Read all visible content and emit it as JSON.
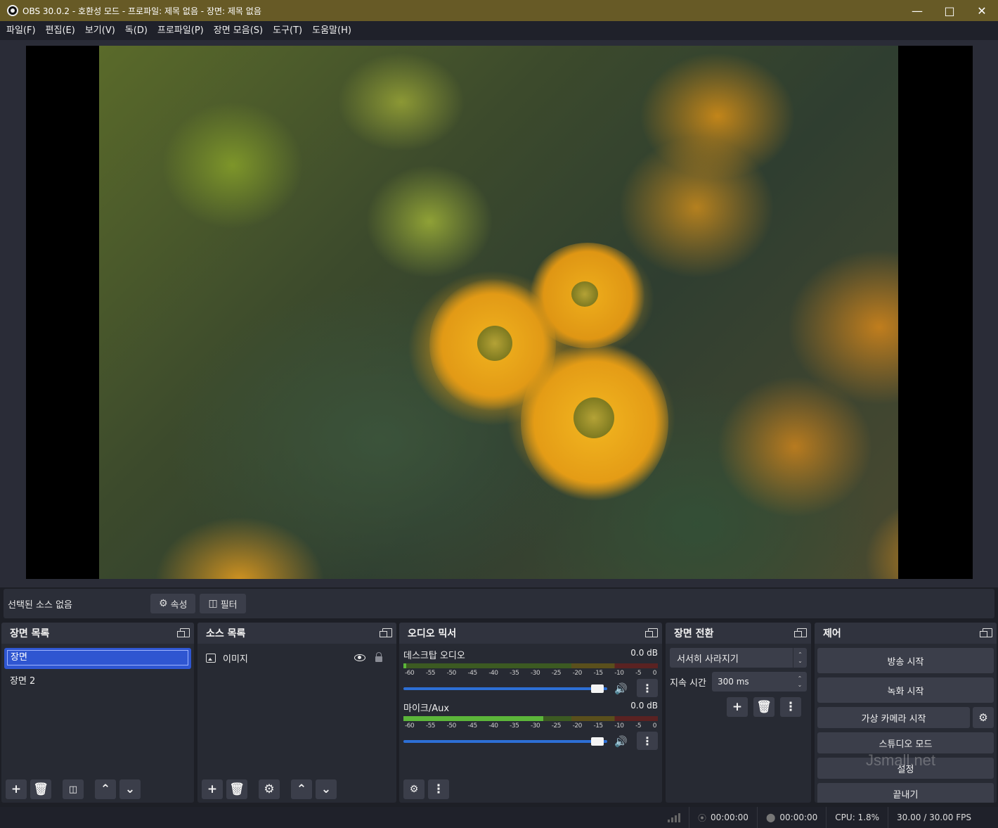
{
  "window": {
    "title": "OBS 30.0.2 - 호환성 모드 - 프로파일: 제목 없음 - 장면: 제목 없음",
    "title_color": "#675a26"
  },
  "menu": [
    "파일(F)",
    "편집(E)",
    "보기(V)",
    "독(D)",
    "프로파일(P)",
    "장면 모음(S)",
    "도구(T)",
    "도움말(H)"
  ],
  "source_bar": {
    "no_source": "선택된 소스 없음",
    "properties": "속성",
    "filters": "필터"
  },
  "scenes": {
    "title": "장면 목록",
    "items": [
      "장면",
      "장면 2"
    ],
    "selected_index": 0
  },
  "sources": {
    "title": "소스 목록",
    "items": [
      {
        "name": "이미지",
        "icon": "image-icon"
      }
    ]
  },
  "mixer": {
    "title": "오디오 믹서",
    "ticks": [
      "-60",
      "-55",
      "-50",
      "-45",
      "-40",
      "-35",
      "-30",
      "-25",
      "-20",
      "-15",
      "-10",
      "-5",
      "0"
    ],
    "channels": [
      {
        "name": "데스크탑 오디오",
        "db": "0.0 dB",
        "volume_fraction": 0.95
      },
      {
        "name": "마이크/Aux",
        "db": "0.0 dB",
        "volume_fraction": 0.95
      }
    ]
  },
  "transitions": {
    "title": "장면 전환",
    "selected": "서서히 사라지기",
    "duration_label": "지속 시간",
    "duration_value": "300 ms"
  },
  "controls": {
    "title": "제어",
    "start_stream": "방송 시작",
    "start_record": "녹화 시작",
    "virtual_cam": "가상 카메라 시작",
    "studio_mode": "스튜디오 모드",
    "settings": "설정",
    "exit": "끝내기"
  },
  "status": {
    "stream_time": "00:00:00",
    "record_time": "00:00:00",
    "cpu": "CPU: 1.8%",
    "fps": "30.00 / 30.00 FPS"
  },
  "watermark": "Jsmall.net"
}
